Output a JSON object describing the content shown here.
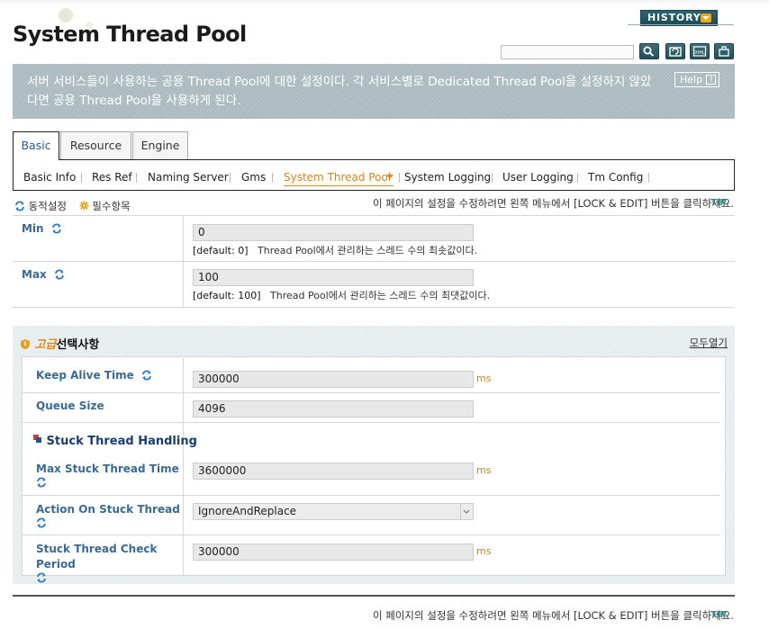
{
  "header": {
    "title": "System Thread Pool",
    "history_label": "HISTORY",
    "search": {
      "value": ""
    },
    "tools": [
      "search-icon",
      "refresh-icon",
      "xml-icon",
      "export-icon"
    ]
  },
  "description": {
    "text": "서버 서비스들이 사용하는 공용 Thread Pool에 대한 설정이다. 각 서비스별로 Dedicated Thread Pool을 설정하지 않았다면 공용 Thread Pool을 사용하게 된다.",
    "help_label": "Help",
    "help_glyph": "?"
  },
  "tabs": [
    {
      "label": "Basic",
      "active": true
    },
    {
      "label": "Resource",
      "active": false
    },
    {
      "label": "Engine",
      "active": false
    }
  ],
  "subtabs": [
    {
      "label": "Basic Info"
    },
    {
      "label": "Res Ref"
    },
    {
      "label": "Naming Server"
    },
    {
      "label": "Gms"
    },
    {
      "label": "System Thread Pool",
      "active": true
    },
    {
      "label": "System Logging"
    },
    {
      "label": "User Logging"
    },
    {
      "label": "Tm Config"
    }
  ],
  "legend": {
    "dynamic": "동적설정",
    "required": "필수항목"
  },
  "tip": {
    "text": "이 페이지의 설정을 수정하려면 왼쪽 메뉴에서 [LOCK & EDIT] 버튼을 클릭하세요.",
    "badge": "TIP"
  },
  "basic_fields": [
    {
      "label": "Min",
      "value": "0",
      "default_label": "[default: 0]",
      "hint": "Thread Pool에서 관리하는 스레드 수의 최솟값이다."
    },
    {
      "label": "Max",
      "value": "100",
      "default_label": "[default: 100]",
      "hint": "Thread Pool에서 관리하는 스레드 수의 최댓값이다."
    }
  ],
  "advanced": {
    "title_prefix": "고급",
    "title_suffix": "선택사항",
    "open_all": "모두열기",
    "fields": [
      {
        "label": "Keep Alive Time",
        "value": "300000",
        "unit": "ms"
      },
      {
        "label": "Queue Size",
        "value": "4096",
        "unit": ""
      }
    ],
    "section_title": "Stuck Thread Handling",
    "section_fields": [
      {
        "label": "Max Stuck Thread Time",
        "value": "3600000",
        "unit": "ms"
      },
      {
        "label": "Action On Stuck Thread",
        "value": "IgnoreAndReplace",
        "unit": ""
      },
      {
        "label": "Stuck Thread Check Period",
        "value": "300000",
        "unit": "ms"
      }
    ]
  },
  "colors": {
    "accent": "#e08a14",
    "label_blue": "#3a6a92",
    "header_bg": "#a9b7bd"
  }
}
